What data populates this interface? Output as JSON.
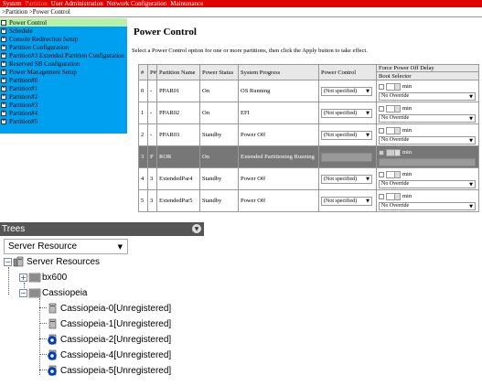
{
  "menubar": {
    "items": [
      "System",
      "Partition",
      "User Administration",
      "Network Configuration",
      "Maintenance"
    ],
    "active_index": 1
  },
  "breadcrumb": ">Partition >Power Control",
  "sidebar": {
    "items": [
      {
        "label": "Power Control",
        "selected": true,
        "expand": ""
      },
      {
        "label": "Schedule",
        "selected": false,
        "expand": "+"
      },
      {
        "label": "Console Redirection Setup",
        "selected": false,
        "expand": "+"
      },
      {
        "label": "Partition Configuration",
        "selected": false,
        "expand": "+"
      },
      {
        "label": "Partition#3 Extended Partition Configuration",
        "selected": false,
        "expand": "+"
      },
      {
        "label": "Reserved SB Configuration",
        "selected": false,
        "expand": "+"
      },
      {
        "label": "Power Management Setup",
        "selected": false,
        "expand": "+"
      },
      {
        "label": "Partition#0",
        "selected": false,
        "expand": "+"
      },
      {
        "label": "Partition#1",
        "selected": false,
        "expand": "+"
      },
      {
        "label": "Partition#2",
        "selected": false,
        "expand": "+"
      },
      {
        "label": "Partition#3",
        "selected": false,
        "expand": "+"
      },
      {
        "label": "Partition#4",
        "selected": false,
        "expand": "+"
      },
      {
        "label": "Partition#5",
        "selected": false,
        "expand": "+"
      }
    ]
  },
  "main": {
    "title": "Power Control",
    "instruction": "Select a Power Control option for one or more partitions, then click the Apply button to take effect."
  },
  "table": {
    "headers": {
      "num": "#",
      "pnum": "P#",
      "name": "Partition Name",
      "status": "Power Status",
      "progress": "System Progress",
      "control": "Power Control",
      "force": "Force Power Off Delay",
      "boot": "Boot Selector"
    },
    "min_label": "min",
    "rows": [
      {
        "num": "0",
        "pnum": "-",
        "name": "PPAR01",
        "status": "On",
        "progress": "OS Running",
        "control": "(Not specified)",
        "boot": "No Override",
        "selected": false
      },
      {
        "num": "1",
        "pnum": "-",
        "name": "PPAR02",
        "status": "On",
        "progress": "EFI",
        "control": "(Not specified)",
        "boot": "No Override",
        "selected": false
      },
      {
        "num": "2",
        "pnum": "-",
        "name": "PPAR03",
        "status": "Standby",
        "progress": "Power Off",
        "control": "(Not specified)",
        "boot": "No Override",
        "selected": false
      },
      {
        "num": "3",
        "pnum": "P",
        "name": "ROR",
        "status": "On",
        "progress": "Extended Partitioning Running",
        "control": "",
        "boot": "",
        "selected": true
      },
      {
        "num": "4",
        "pnum": "3",
        "name": "ExtendedPar4",
        "status": "Standby",
        "progress": "Power Off",
        "control": "(Not specified)",
        "boot": "No Override",
        "selected": false
      },
      {
        "num": "5",
        "pnum": "3",
        "name": "ExtendedPar5",
        "status": "Standby",
        "progress": "Power Off",
        "control": "(Not specified)",
        "boot": "No Override",
        "selected": false
      }
    ]
  },
  "trees": {
    "title": "Trees",
    "select_value": "Server Resource",
    "root": "Server Resources",
    "nodes": [
      {
        "label": "bx600",
        "kind": "chassis"
      },
      {
        "label": "Cassiopeia",
        "kind": "chassis"
      },
      {
        "label": "Cassiopeia-0[Unregistered]",
        "kind": "server"
      },
      {
        "label": "Cassiopeia-1[Unregistered]",
        "kind": "server"
      },
      {
        "label": "Cassiopeia-2[Unregistered]",
        "kind": "server-blue"
      },
      {
        "label": "Cassiopeia-4[Unregistered]",
        "kind": "server-blue"
      },
      {
        "label": "Cassiopeia-5[Unregistered]",
        "kind": "server-blue"
      }
    ]
  }
}
